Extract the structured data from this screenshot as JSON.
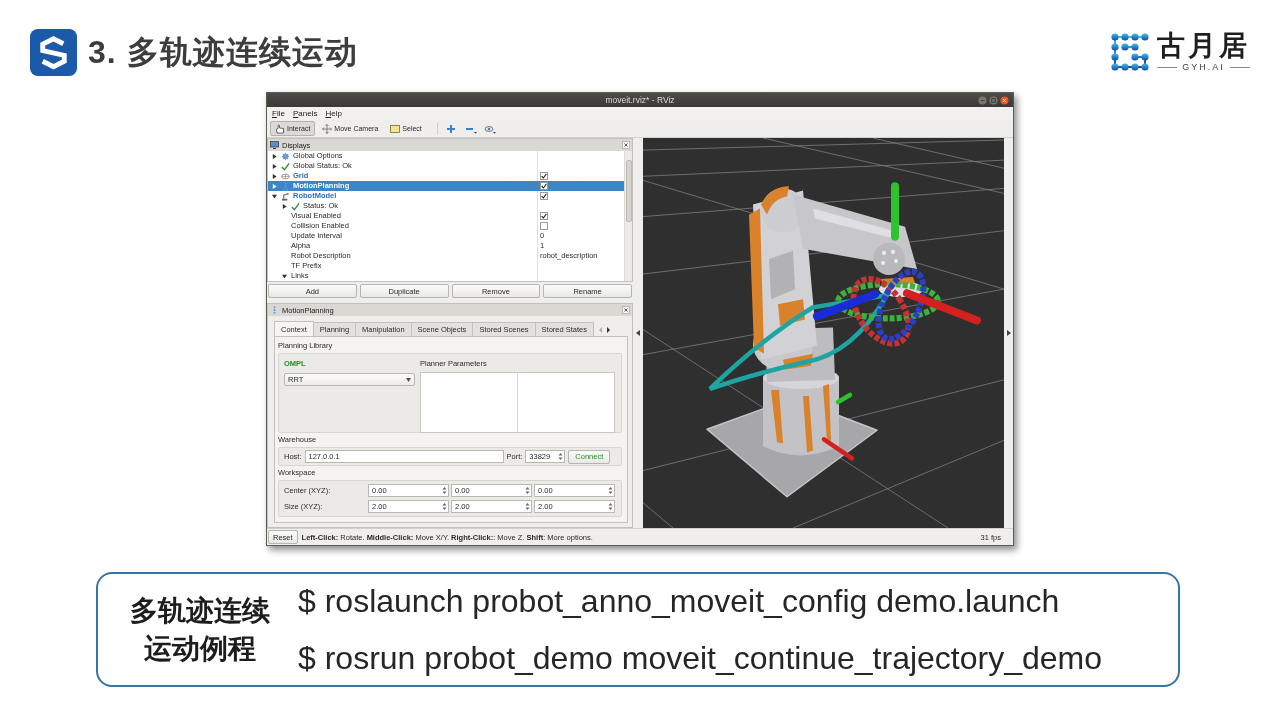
{
  "header": {
    "title": "3. 多轨迹连续运动"
  },
  "logo": {
    "name": "古月居",
    "tagline": "GYH.AI"
  },
  "window": {
    "title": "moveit.rviz* - RViz",
    "menu": [
      "File",
      "Panels",
      "Help"
    ],
    "tools": [
      {
        "label": "Interact",
        "kind": "interact",
        "selected": true
      },
      {
        "label": "Move Camera",
        "kind": "camera",
        "selected": false
      },
      {
        "label": "Select",
        "kind": "select",
        "selected": false
      }
    ]
  },
  "displays": {
    "title": "Displays",
    "rows": [
      {
        "label": "Global Options",
        "kind": "options",
        "expanded": false,
        "selected": false
      },
      {
        "label": "Global Status: Ok",
        "kind": "status",
        "expanded": false,
        "selected": false
      },
      {
        "label": "Grid",
        "kind": "grid",
        "expanded": false,
        "checked": true,
        "selected": false
      },
      {
        "label": "MotionPlanning",
        "kind": "planner",
        "expanded": false,
        "checked": true,
        "selected": true
      },
      {
        "label": "RobotModel",
        "kind": "robot",
        "expanded": true,
        "checked": true,
        "selected": false,
        "children": [
          {
            "label": "Status: Ok",
            "kind": "status",
            "expanded": false,
            "selected": false
          },
          {
            "label": "Visual Enabled",
            "kind": "property",
            "checked": true,
            "selected": false
          },
          {
            "label": "Collision Enabled",
            "kind": "property",
            "checked": false,
            "selected": false
          },
          {
            "label": "Update Interval",
            "kind": "property",
            "value": "0",
            "selected": false
          },
          {
            "label": "Alpha",
            "kind": "property",
            "value": "1",
            "selected": false
          },
          {
            "label": "Robot Description",
            "kind": "property",
            "value": "robot_description",
            "selected": false
          },
          {
            "label": "TF Prefix",
            "kind": "property",
            "selected": false
          },
          {
            "label": "Links",
            "kind": "property",
            "expanded": true,
            "selected": false
          }
        ]
      }
    ],
    "buttons": [
      "Add",
      "Duplicate",
      "Remove",
      "Rename"
    ]
  },
  "motion_planning": {
    "title": "MotionPlanning",
    "tabs": [
      {
        "label": "Context",
        "selected": true
      },
      {
        "label": "Planning",
        "selected": false
      },
      {
        "label": "Manipulation",
        "selected": false
      },
      {
        "label": "Scene Objects",
        "selected": false
      },
      {
        "label": "Stored Scenes",
        "selected": false
      },
      {
        "label": "Stored States",
        "selected": false
      }
    ],
    "planning_library": {
      "label": "Planning Library",
      "library": "OMPL",
      "planner": "RRT",
      "parameters_label": "Planner Parameters"
    },
    "warehouse": {
      "label": "Warehouse",
      "host_label": "Host:",
      "host": "127.0.0.1",
      "port_label": "Port:",
      "port": "33829",
      "connect": "Connect"
    },
    "workspace": {
      "label": "Workspace",
      "rows": [
        {
          "label": "Center (XYZ):",
          "values": [
            "0.00",
            "0.00",
            "0.00"
          ]
        },
        {
          "label": "Size (XYZ):",
          "values": [
            "2.00",
            "2.00",
            "2.00"
          ]
        }
      ]
    }
  },
  "status_bar": {
    "reset": "Reset",
    "hint": "**Left-Click:** Rotate. **Middle-Click:** Move X/Y. **Right-Click:**: Move Z. **Shift**: More options.",
    "fps": "31 fps"
  },
  "example": {
    "heading": "多轨迹连续运动例程",
    "commands": [
      "$ roslaunch probot_anno_moveit_config demo.launch",
      "$ rosrun probot_demo moveit_continue_trajectory_demo"
    ]
  }
}
